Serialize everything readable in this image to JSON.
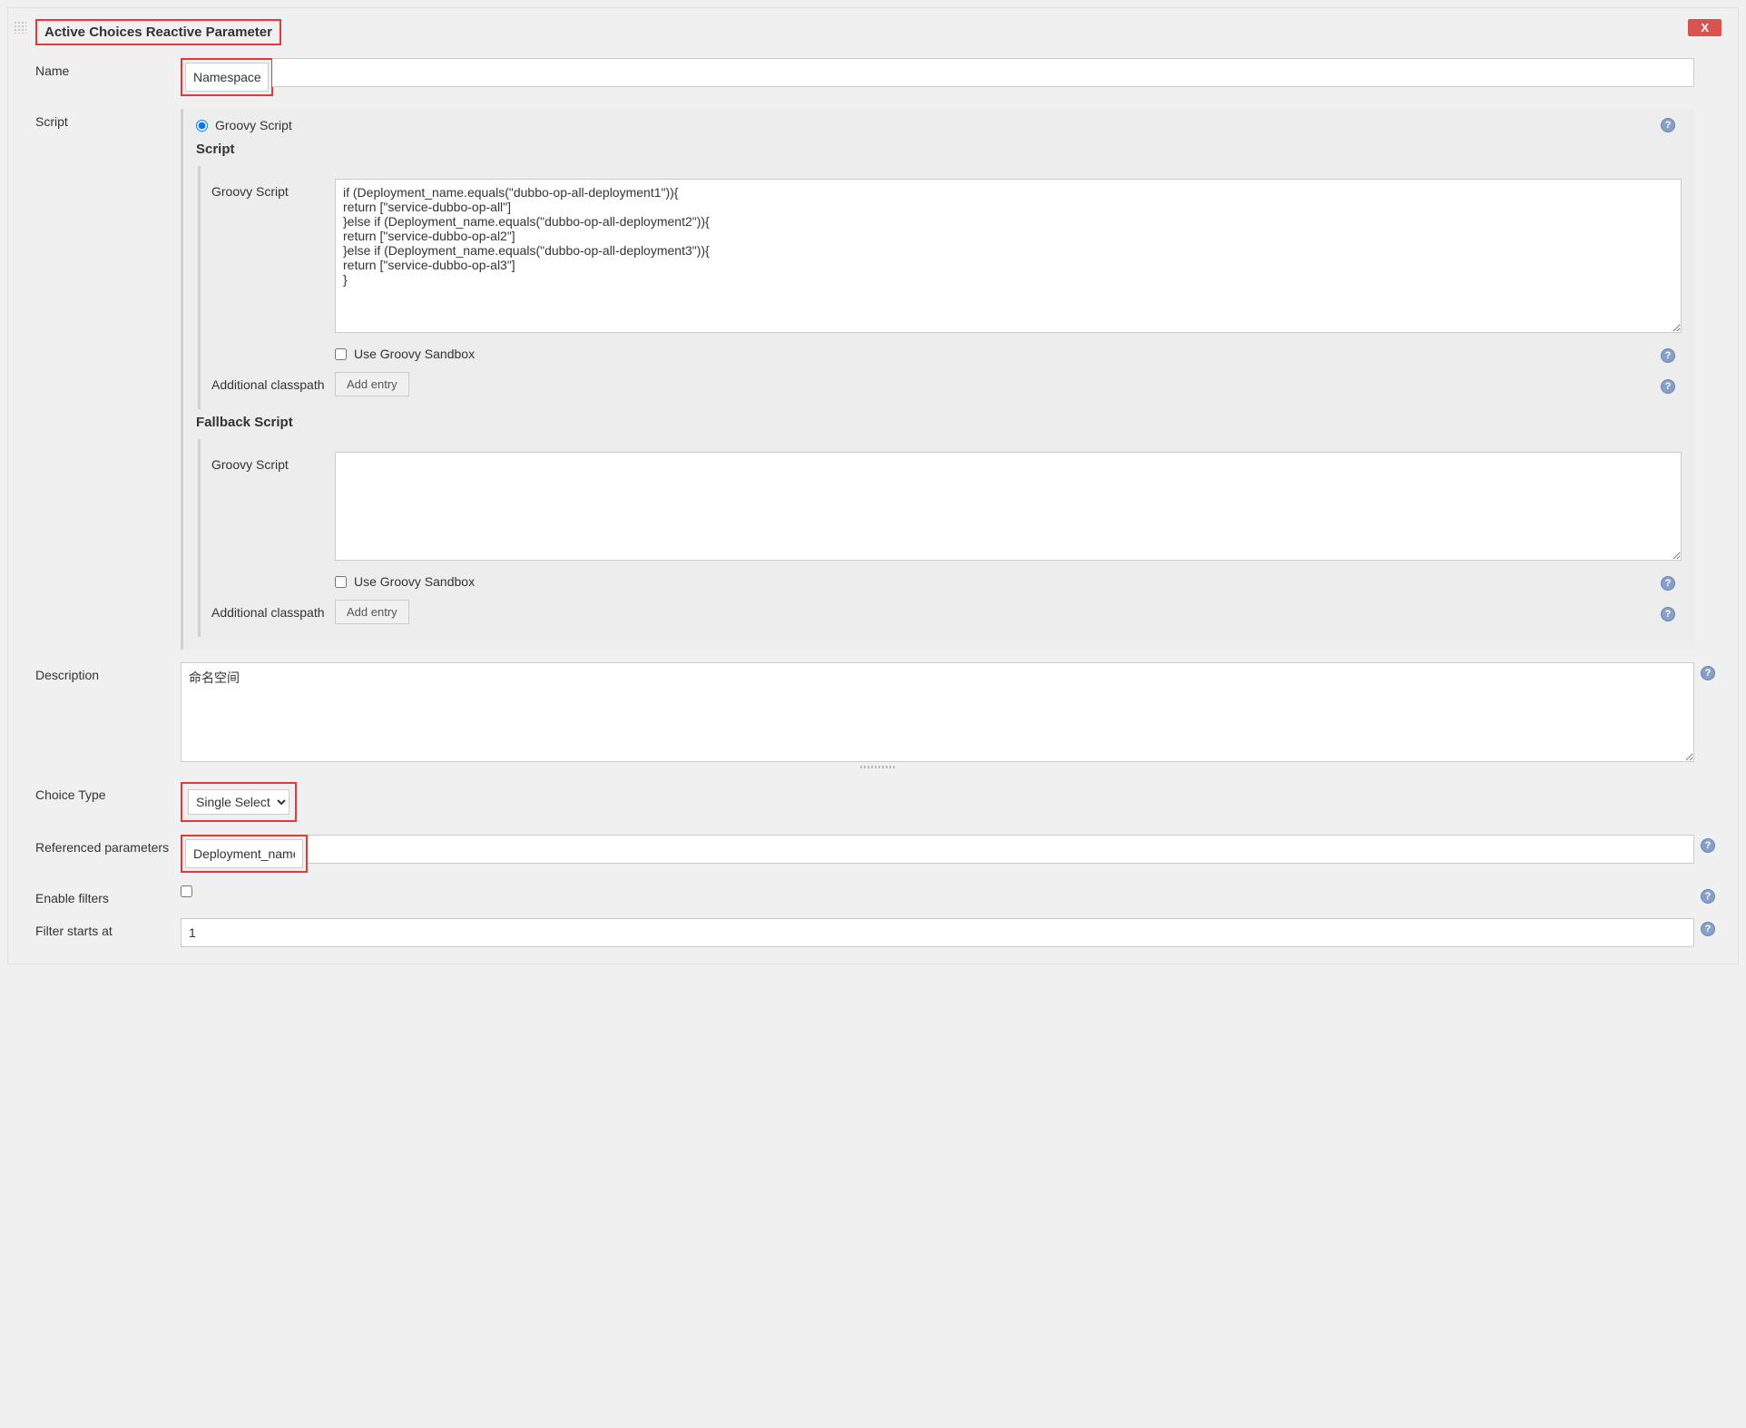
{
  "title": "Active Choices Reactive Parameter",
  "close_label": "X",
  "labels": {
    "name": "Name",
    "script": "Script",
    "description": "Description",
    "choice_type": "Choice Type",
    "ref_params": "Referenced parameters",
    "enable_filters": "Enable filters",
    "filter_starts": "Filter starts at"
  },
  "name_value": "Namespace",
  "script_section": {
    "radio_groovy": "Groovy Script",
    "heading": "Script",
    "groovy_label": "Groovy Script",
    "groovy_code": "if (Deployment_name.equals(\"dubbo-op-all-deployment1\")){\nreturn [\"service-dubbo-op-all\"]\n}else if (Deployment_name.equals(\"dubbo-op-all-deployment2\")){\nreturn [\"service-dubbo-op-al2\"]\n}else if (Deployment_name.equals(\"dubbo-op-all-deployment3\")){\nreturn [\"service-dubbo-op-al3\"]\n}",
    "sandbox_label": "Use Groovy Sandbox",
    "classpath_label": "Additional classpath",
    "add_entry": "Add entry",
    "fallback_heading": "Fallback Script",
    "fallback_code": ""
  },
  "description_value": "命名空间",
  "choice_type_value": "Single Select",
  "ref_params_value": "Deployment_name",
  "filter_starts_value": "1"
}
